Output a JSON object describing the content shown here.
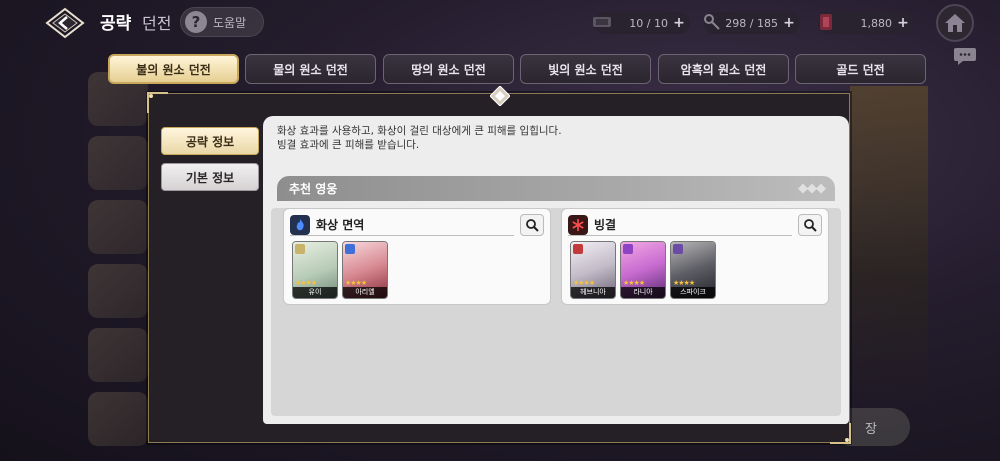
{
  "header": {
    "title": "공략",
    "subtitle": "던전",
    "help_label": "도움말"
  },
  "resources": [
    {
      "icon": "ticket-icon",
      "value": "10 / 10"
    },
    {
      "icon": "key-icon",
      "value": "298 / 185"
    },
    {
      "icon": "gem-icon",
      "value": "1,880"
    }
  ],
  "tabs": [
    {
      "label": "불의 원소 던전",
      "active": true
    },
    {
      "label": "물의 원소 던전",
      "active": false
    },
    {
      "label": "땅의 원소 던전",
      "active": false
    },
    {
      "label": "빛의 원소 던전",
      "active": false
    },
    {
      "label": "암흑의 원소 던전",
      "active": false
    },
    {
      "label": "골드 던전",
      "active": false
    }
  ],
  "background": {
    "bottom_button": "장"
  },
  "modal": {
    "side_tabs": [
      "공략 정보",
      "기본 정보"
    ],
    "description_lines": [
      "화상 효과를 사용하고, 화상이 걸린 대상에게 큰 피해를 입힙니다.",
      "빙결 효과에 큰 피해를 받습니다."
    ],
    "recommend_title": "추천 영웅",
    "groups": [
      {
        "title": "화상 면역",
        "icon": "burn-immunity-icon",
        "heroes": [
          {
            "name": "유이",
            "stars": "★★★★",
            "colors": [
              "#d8e6d4",
              "#8aa890"
            ]
          },
          {
            "name": "아리엘",
            "stars": "★★★★",
            "colors": [
              "#f2c8cc",
              "#9a3a44"
            ]
          }
        ]
      },
      {
        "title": "빙결",
        "icon": "freeze-icon",
        "heroes": [
          {
            "name": "헤브니아",
            "stars": "★★★★",
            "colors": [
              "#e6e0e8",
              "#8c8494"
            ]
          },
          {
            "name": "라니아",
            "stars": "★★★★",
            "colors": [
              "#e895d8",
              "#7b3c8c"
            ]
          },
          {
            "name": "스파이크",
            "stars": "★★★★",
            "colors": [
              "#8a8a8a",
              "#2f2f38"
            ]
          }
        ]
      }
    ]
  },
  "colors": {
    "accent_gold": "#c9a75b",
    "tab_active_bg": "#f1e2b5",
    "panel_bg": "#ededed"
  }
}
